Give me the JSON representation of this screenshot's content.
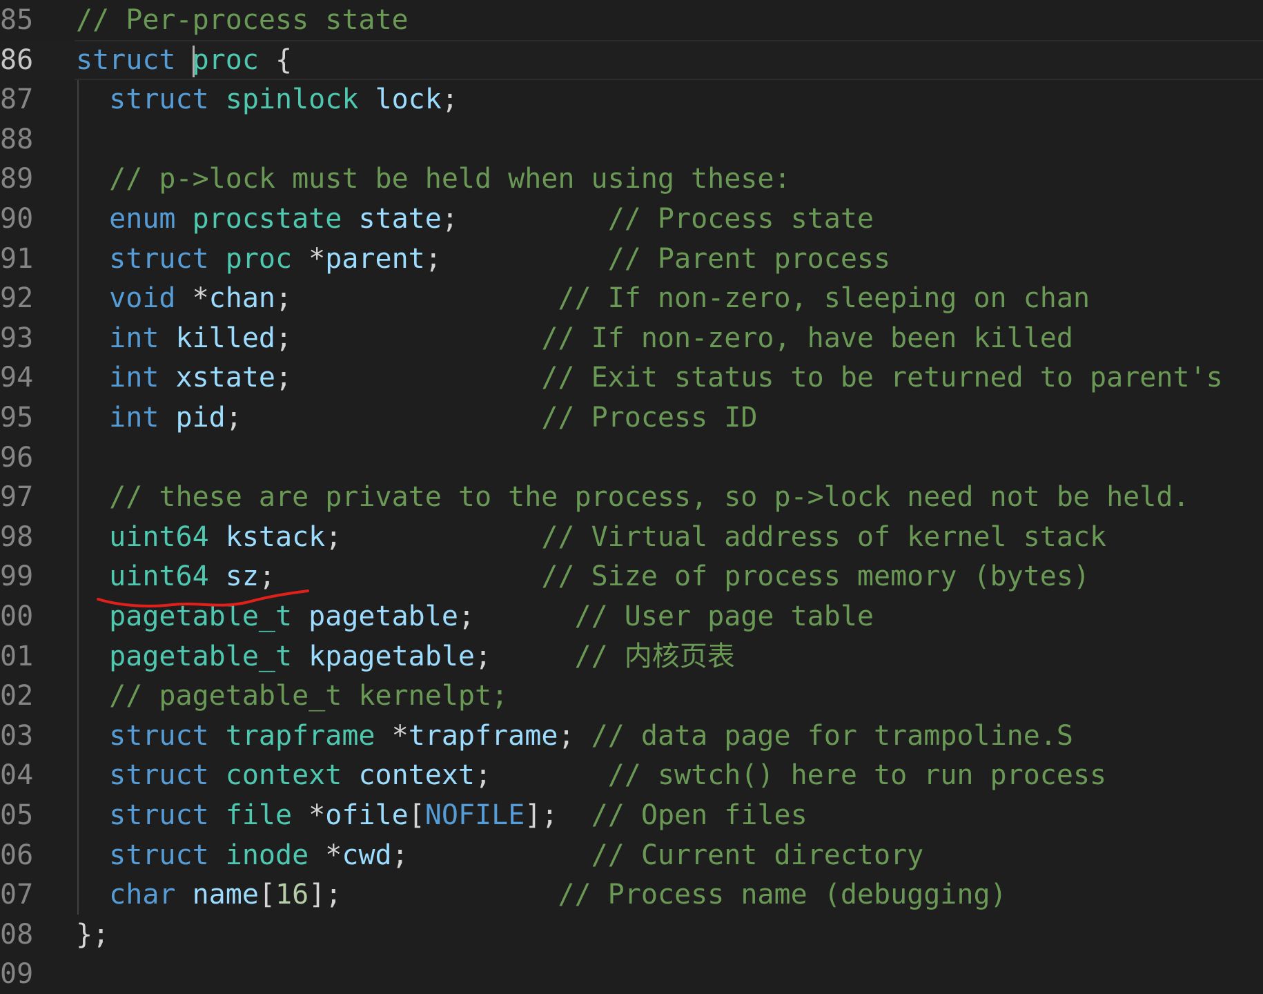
{
  "editor": {
    "colors": {
      "background": "#1e1e1e",
      "keyword": "#569cd6",
      "type": "#4ec9b0",
      "variable": "#9cdcfe",
      "comment": "#6a9955",
      "punctuation": "#d4d4d4",
      "line_number": "#858585",
      "annotation": "#e0201a"
    },
    "lines": [
      {
        "no": "85",
        "tokens": [
          {
            "t": "// Per-process state",
            "c": "cm"
          }
        ]
      },
      {
        "no": "86",
        "tokens": [
          {
            "t": "struct",
            "c": "kw"
          },
          {
            "t": " ",
            "c": "pn"
          },
          {
            "t": "proc",
            "c": "ty",
            "cursor": true
          },
          {
            "t": " {",
            "c": "pn"
          }
        ]
      },
      {
        "no": "87",
        "tokens": [
          {
            "t": "  ",
            "c": "pn"
          },
          {
            "t": "struct",
            "c": "kw"
          },
          {
            "t": " ",
            "c": "pn"
          },
          {
            "t": "spinlock",
            "c": "ty"
          },
          {
            "t": " ",
            "c": "pn"
          },
          {
            "t": "lock",
            "c": "var"
          },
          {
            "t": ";",
            "c": "pn"
          }
        ]
      },
      {
        "no": "88",
        "tokens": []
      },
      {
        "no": "89",
        "tokens": [
          {
            "t": "  ",
            "c": "pn"
          },
          {
            "t": "// p->lock must be held when using these:",
            "c": "cm"
          }
        ]
      },
      {
        "no": "90",
        "tokens": [
          {
            "t": "  ",
            "c": "pn"
          },
          {
            "t": "enum",
            "c": "kw"
          },
          {
            "t": " ",
            "c": "pn"
          },
          {
            "t": "procstate",
            "c": "ty"
          },
          {
            "t": " ",
            "c": "pn"
          },
          {
            "t": "state",
            "c": "var"
          },
          {
            "t": ";         ",
            "c": "pn"
          },
          {
            "t": "// Process state",
            "c": "cm"
          }
        ]
      },
      {
        "no": "91",
        "tokens": [
          {
            "t": "  ",
            "c": "pn"
          },
          {
            "t": "struct",
            "c": "kw"
          },
          {
            "t": " ",
            "c": "pn"
          },
          {
            "t": "proc",
            "c": "ty"
          },
          {
            "t": " *",
            "c": "pn"
          },
          {
            "t": "parent",
            "c": "var"
          },
          {
            "t": ";          ",
            "c": "pn"
          },
          {
            "t": "// Parent process",
            "c": "cm"
          }
        ]
      },
      {
        "no": "92",
        "tokens": [
          {
            "t": "  ",
            "c": "pn"
          },
          {
            "t": "void",
            "c": "kw"
          },
          {
            "t": " *",
            "c": "pn"
          },
          {
            "t": "chan",
            "c": "var"
          },
          {
            "t": ";                ",
            "c": "pn"
          },
          {
            "t": "// If non-zero, sleeping on chan",
            "c": "cm"
          }
        ]
      },
      {
        "no": "93",
        "tokens": [
          {
            "t": "  ",
            "c": "pn"
          },
          {
            "t": "int",
            "c": "kw"
          },
          {
            "t": " ",
            "c": "pn"
          },
          {
            "t": "killed",
            "c": "var"
          },
          {
            "t": ";               ",
            "c": "pn"
          },
          {
            "t": "// If non-zero, have been killed",
            "c": "cm"
          }
        ]
      },
      {
        "no": "94",
        "tokens": [
          {
            "t": "  ",
            "c": "pn"
          },
          {
            "t": "int",
            "c": "kw"
          },
          {
            "t": " ",
            "c": "pn"
          },
          {
            "t": "xstate",
            "c": "var"
          },
          {
            "t": ";               ",
            "c": "pn"
          },
          {
            "t": "// Exit status to be returned to parent's",
            "c": "cm"
          }
        ]
      },
      {
        "no": "95",
        "tokens": [
          {
            "t": "  ",
            "c": "pn"
          },
          {
            "t": "int",
            "c": "kw"
          },
          {
            "t": " ",
            "c": "pn"
          },
          {
            "t": "pid",
            "c": "var"
          },
          {
            "t": ";                  ",
            "c": "pn"
          },
          {
            "t": "// Process ID",
            "c": "cm"
          }
        ]
      },
      {
        "no": "96",
        "tokens": []
      },
      {
        "no": "97",
        "tokens": [
          {
            "t": "  ",
            "c": "pn"
          },
          {
            "t": "// these are private to the process, so p->lock need not be held.",
            "c": "cm"
          }
        ]
      },
      {
        "no": "98",
        "tokens": [
          {
            "t": "  ",
            "c": "pn"
          },
          {
            "t": "uint64",
            "c": "ty"
          },
          {
            "t": " ",
            "c": "pn"
          },
          {
            "t": "kstack",
            "c": "var"
          },
          {
            "t": ";            ",
            "c": "pn"
          },
          {
            "t": "// Virtual address of kernel stack",
            "c": "cm"
          }
        ]
      },
      {
        "no": "99",
        "tokens": [
          {
            "t": "  ",
            "c": "pn"
          },
          {
            "t": "uint64",
            "c": "ty"
          },
          {
            "t": " ",
            "c": "pn"
          },
          {
            "t": "sz",
            "c": "var"
          },
          {
            "t": ";                ",
            "c": "pn"
          },
          {
            "t": "// Size of process memory (bytes)",
            "c": "cm"
          }
        ]
      },
      {
        "no": "00",
        "tokens": [
          {
            "t": "  ",
            "c": "pn"
          },
          {
            "t": "pagetable_t",
            "c": "ty"
          },
          {
            "t": " ",
            "c": "pn"
          },
          {
            "t": "pagetable",
            "c": "var"
          },
          {
            "t": ";      ",
            "c": "pn"
          },
          {
            "t": "// User page table",
            "c": "cm"
          }
        ]
      },
      {
        "no": "01",
        "tokens": [
          {
            "t": "  ",
            "c": "pn"
          },
          {
            "t": "pagetable_t",
            "c": "ty"
          },
          {
            "t": " ",
            "c": "pn"
          },
          {
            "t": "kpagetable",
            "c": "var"
          },
          {
            "t": ";     ",
            "c": "pn"
          },
          {
            "t": "// 内核页表",
            "c": "cm"
          }
        ]
      },
      {
        "no": "02",
        "tokens": [
          {
            "t": "  ",
            "c": "pn"
          },
          {
            "t": "// pagetable_t kernelpt;",
            "c": "cm"
          }
        ]
      },
      {
        "no": "03",
        "tokens": [
          {
            "t": "  ",
            "c": "pn"
          },
          {
            "t": "struct",
            "c": "kw"
          },
          {
            "t": " ",
            "c": "pn"
          },
          {
            "t": "trapframe",
            "c": "ty"
          },
          {
            "t": " *",
            "c": "pn"
          },
          {
            "t": "trapframe",
            "c": "var"
          },
          {
            "t": "; ",
            "c": "pn"
          },
          {
            "t": "// data page for trampoline.S",
            "c": "cm"
          }
        ]
      },
      {
        "no": "04",
        "tokens": [
          {
            "t": "  ",
            "c": "pn"
          },
          {
            "t": "struct",
            "c": "kw"
          },
          {
            "t": " ",
            "c": "pn"
          },
          {
            "t": "context",
            "c": "ty"
          },
          {
            "t": " ",
            "c": "pn"
          },
          {
            "t": "context",
            "c": "var"
          },
          {
            "t": ";       ",
            "c": "pn"
          },
          {
            "t": "// swtch() here to run process",
            "c": "cm"
          }
        ]
      },
      {
        "no": "05",
        "tokens": [
          {
            "t": "  ",
            "c": "pn"
          },
          {
            "t": "struct",
            "c": "kw"
          },
          {
            "t": " ",
            "c": "pn"
          },
          {
            "t": "file",
            "c": "ty"
          },
          {
            "t": " *",
            "c": "pn"
          },
          {
            "t": "ofile",
            "c": "var"
          },
          {
            "t": "[",
            "c": "pn"
          },
          {
            "t": "NOFILE",
            "c": "mac"
          },
          {
            "t": "];  ",
            "c": "pn"
          },
          {
            "t": "// Open files",
            "c": "cm"
          }
        ]
      },
      {
        "no": "06",
        "tokens": [
          {
            "t": "  ",
            "c": "pn"
          },
          {
            "t": "struct",
            "c": "kw"
          },
          {
            "t": " ",
            "c": "pn"
          },
          {
            "t": "inode",
            "c": "ty"
          },
          {
            "t": " *",
            "c": "pn"
          },
          {
            "t": "cwd",
            "c": "var"
          },
          {
            "t": ";           ",
            "c": "pn"
          },
          {
            "t": "// Current directory",
            "c": "cm"
          }
        ]
      },
      {
        "no": "07",
        "tokens": [
          {
            "t": "  ",
            "c": "pn"
          },
          {
            "t": "char",
            "c": "kw"
          },
          {
            "t": " ",
            "c": "pn"
          },
          {
            "t": "name",
            "c": "var"
          },
          {
            "t": "[",
            "c": "pn"
          },
          {
            "t": "16",
            "c": "num"
          },
          {
            "t": "];             ",
            "c": "pn"
          },
          {
            "t": "// Process name (debugging)",
            "c": "cm"
          }
        ]
      },
      {
        "no": "08",
        "tokens": [
          {
            "t": "};",
            "c": "pn"
          }
        ]
      },
      {
        "no": "09",
        "tokens": []
      }
    ],
    "current_line": "86"
  }
}
